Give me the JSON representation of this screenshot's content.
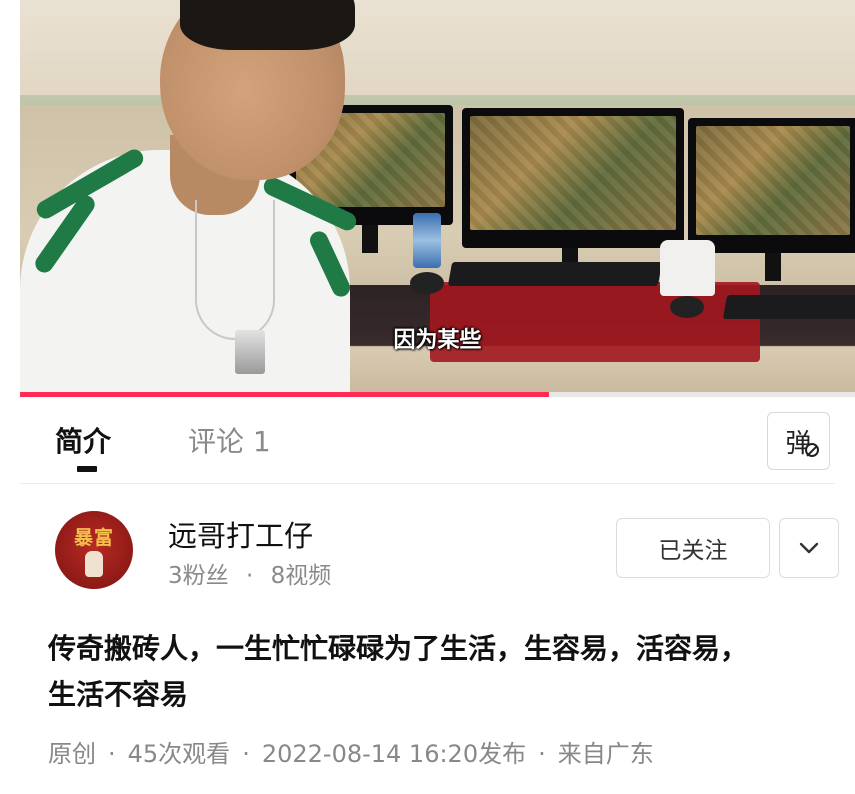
{
  "video": {
    "subtitle": "因为某些",
    "progress": 0.633
  },
  "tabs": [
    {
      "label": "简介",
      "active": true
    },
    {
      "label": "评论 1",
      "active": false
    }
  ],
  "danmaku_button": {
    "label": "弹",
    "icon": "danmaku-off-icon"
  },
  "author": {
    "avatar_text": "暴富",
    "name": "远哥打工仔",
    "followers": "3粉丝",
    "separator": "·",
    "videos": "8视频",
    "follow_label": "已关注",
    "more_icon": "chevron-down-icon"
  },
  "description": "传奇搬砖人，一生忙忙碌碌为了生活，生容易，活容易，生活不容易",
  "meta": {
    "original": "原创",
    "views": "45次观看",
    "published": "2022-08-14 16:20发布",
    "location": "来自广东"
  },
  "colors": {
    "accent": "#fe2c55",
    "muted_text": "#8a8a8a"
  }
}
